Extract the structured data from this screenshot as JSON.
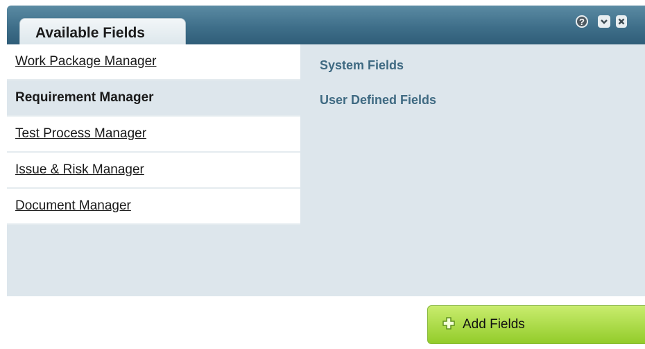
{
  "panel": {
    "title": "Available Fields",
    "controls": {
      "help": "?",
      "collapse_icon": "chevron-down-icon",
      "close_icon": "close-icon"
    }
  },
  "left_list": {
    "items": [
      {
        "label": "Work Package Manager",
        "active": false
      },
      {
        "label": "Requirement Manager",
        "active": true
      },
      {
        "label": "Test Process Manager",
        "active": false
      },
      {
        "label": "Issue & Risk Manager",
        "active": false
      },
      {
        "label": "Document Manager",
        "active": false
      }
    ]
  },
  "right_list": {
    "items": [
      {
        "label": "System Fields"
      },
      {
        "label": "User Defined Fields"
      }
    ]
  },
  "footer": {
    "add_button_label": "Add Fields",
    "add_button_icon": "plus-icon"
  },
  "colors": {
    "header": "#3f6f8a",
    "content_bg": "#dde6ec",
    "accent_text": "#3f6a82",
    "button_green": "#93cc2a"
  }
}
